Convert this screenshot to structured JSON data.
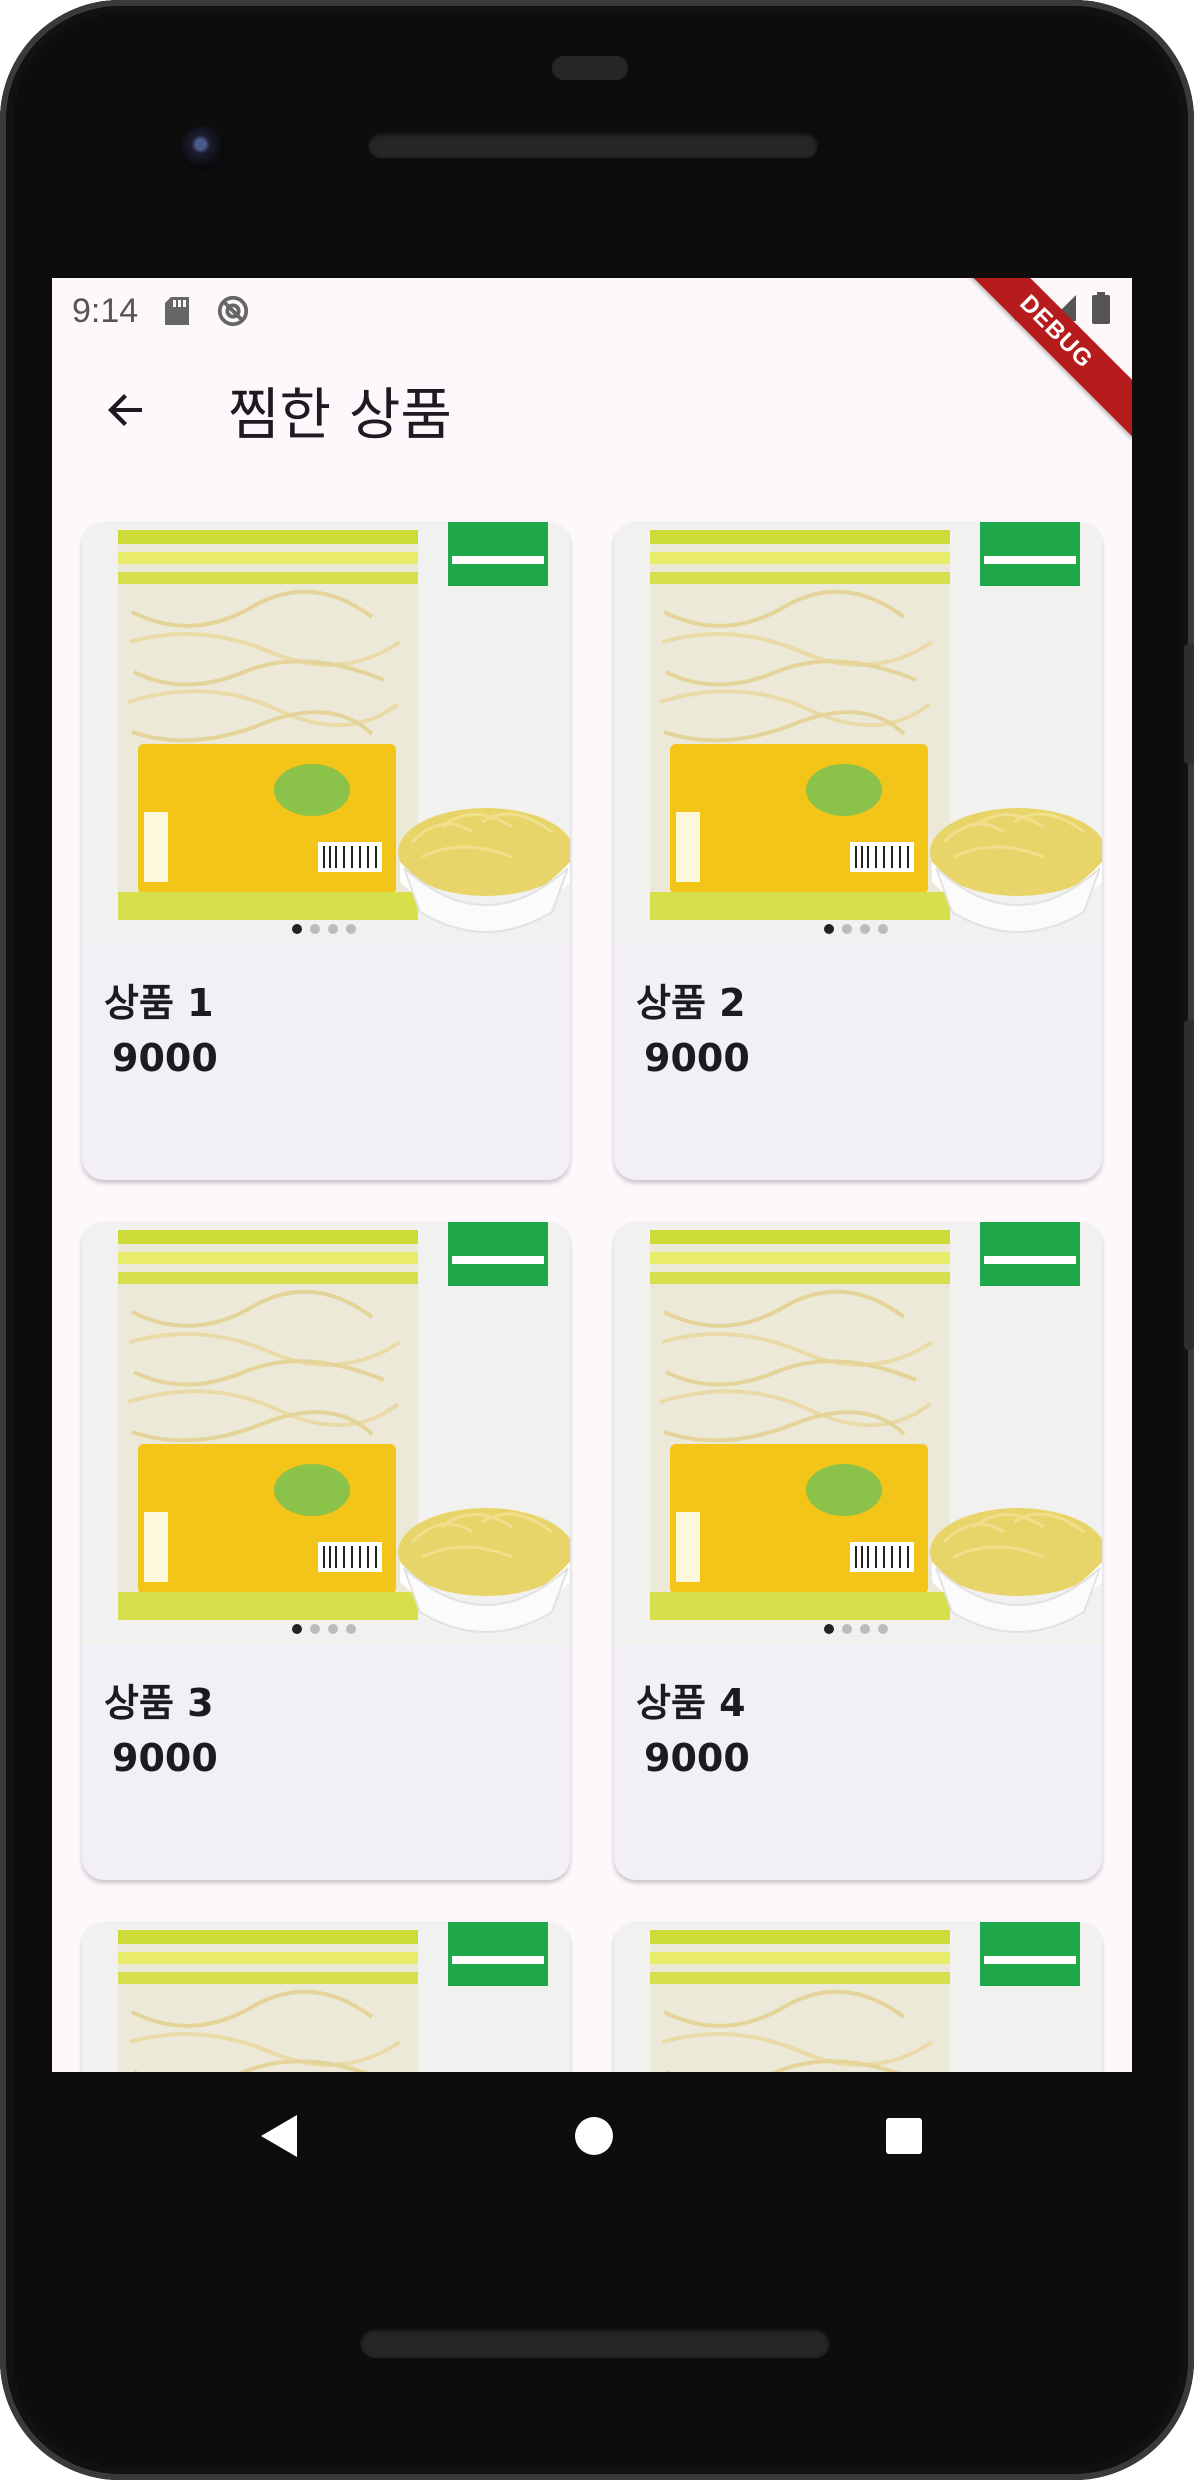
{
  "status_bar": {
    "time": "9:14",
    "debug_banner": "DEBUG"
  },
  "app_bar": {
    "title": "찜한 상품"
  },
  "products": [
    {
      "name": "상품 1",
      "price": "9000"
    },
    {
      "name": "상품 2",
      "price": "9000"
    },
    {
      "name": "상품 3",
      "price": "9000"
    },
    {
      "name": "상품 4",
      "price": "9000"
    },
    {
      "name": "",
      "price": ""
    },
    {
      "name": "",
      "price": ""
    }
  ],
  "colors": {
    "screen_background": "#fdf8fc",
    "card_background": "#f3eff7",
    "debug_ribbon": "#b71c1c",
    "gap_badge": "#1fa84a",
    "package_yellow": "#f2c518"
  },
  "icons": {
    "back": "arrow-left-icon",
    "nav_back": "triangle-back-icon",
    "nav_home": "circle-home-icon",
    "nav_recents": "square-recents-icon"
  }
}
